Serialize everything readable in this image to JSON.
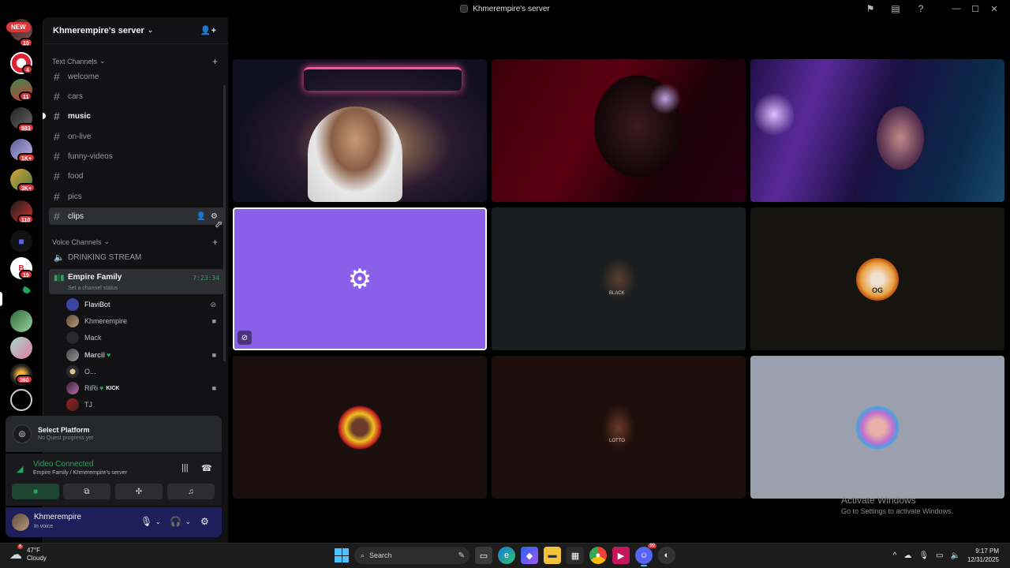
{
  "window": {
    "title": "Khmerempire's server"
  },
  "rail": {
    "new_label": "NEW",
    "badges": [
      "10",
      "4",
      "11",
      "583",
      "1K+",
      "3K+",
      "110",
      "19",
      "360"
    ]
  },
  "guild": {
    "name": "Khmerempire's server"
  },
  "text_category": "Text Channels",
  "text_channels": [
    {
      "name": "welcome"
    },
    {
      "name": "cars"
    },
    {
      "name": "music"
    },
    {
      "name": "on-live"
    },
    {
      "name": "funny-videos"
    },
    {
      "name": "food"
    },
    {
      "name": "pics"
    },
    {
      "name": "clips"
    }
  ],
  "voice_category": "Voice Channels",
  "voice_channels": [
    {
      "name": "DRINKING STREAM"
    },
    {
      "name": "Empire Family",
      "status_placeholder": "Set a channel status",
      "timer": "7:23:34"
    }
  ],
  "members": [
    {
      "name": "FlaviBot"
    },
    {
      "name": "Khmerempire"
    },
    {
      "name": "Mack"
    },
    {
      "name": "Marcii"
    },
    {
      "name": "O..."
    },
    {
      "name": "RiRi",
      "tag": "KICK"
    },
    {
      "name": "TJ"
    }
  ],
  "quest": {
    "title": "Select Platform",
    "subtitle": "No Quest progress yet"
  },
  "rtc": {
    "status": "Video Connected",
    "location": "Empire Family / Khmerempire's server"
  },
  "user_panel": {
    "name": "Khmerempire",
    "status": "In voice"
  },
  "tile_labels": {
    "blackk": "BLACK",
    "lotto": "LOTTO",
    "og": "OG"
  },
  "watermark": {
    "title": "Activate Windows",
    "subtitle": "Go to Settings to activate Windows."
  },
  "taskbar": {
    "weather_temp": "47°F",
    "weather_desc": "Cloudy",
    "weather_badge": "6",
    "search_placeholder": "Search",
    "discord_badge": "99",
    "time": "9:17 PM",
    "date": "12/31/2025"
  },
  "colors": {
    "accent": "#23a55a",
    "speaking_tile": "#8a60e8",
    "user_panel": "#1e1f5a",
    "danger": "#da373c"
  }
}
